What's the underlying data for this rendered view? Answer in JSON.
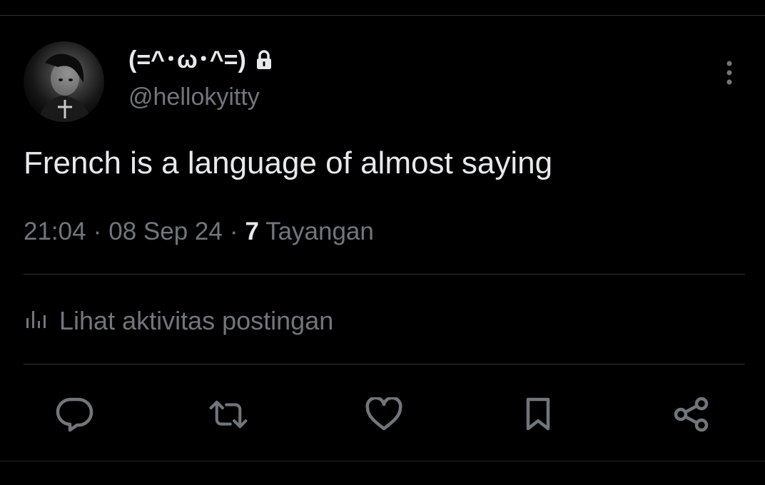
{
  "author": {
    "display_name": "(=^･ω･^=)",
    "handle": "@hellokyitty",
    "protected_icon": "lock-icon",
    "avatar_icon": "avatar-photo"
  },
  "tweet": {
    "text": "French is a language of almost saying"
  },
  "meta": {
    "time": "21:04",
    "separator": "·",
    "date": "08 Sep 24",
    "views_count": "7",
    "views_label": "Tayangan"
  },
  "activity": {
    "icon": "analytics-icon",
    "label": "Lihat aktivitas postingan"
  },
  "actions": {
    "reply_icon": "reply-icon",
    "repost_icon": "repost-icon",
    "like_icon": "like-icon",
    "bookmark_icon": "bookmark-icon",
    "share_icon": "share-icon",
    "more_icon": "more-options-icon"
  },
  "colors": {
    "background": "#000000",
    "primary_text": "#e7e9ea",
    "secondary_text": "#71767b",
    "divider": "#2f3336"
  }
}
